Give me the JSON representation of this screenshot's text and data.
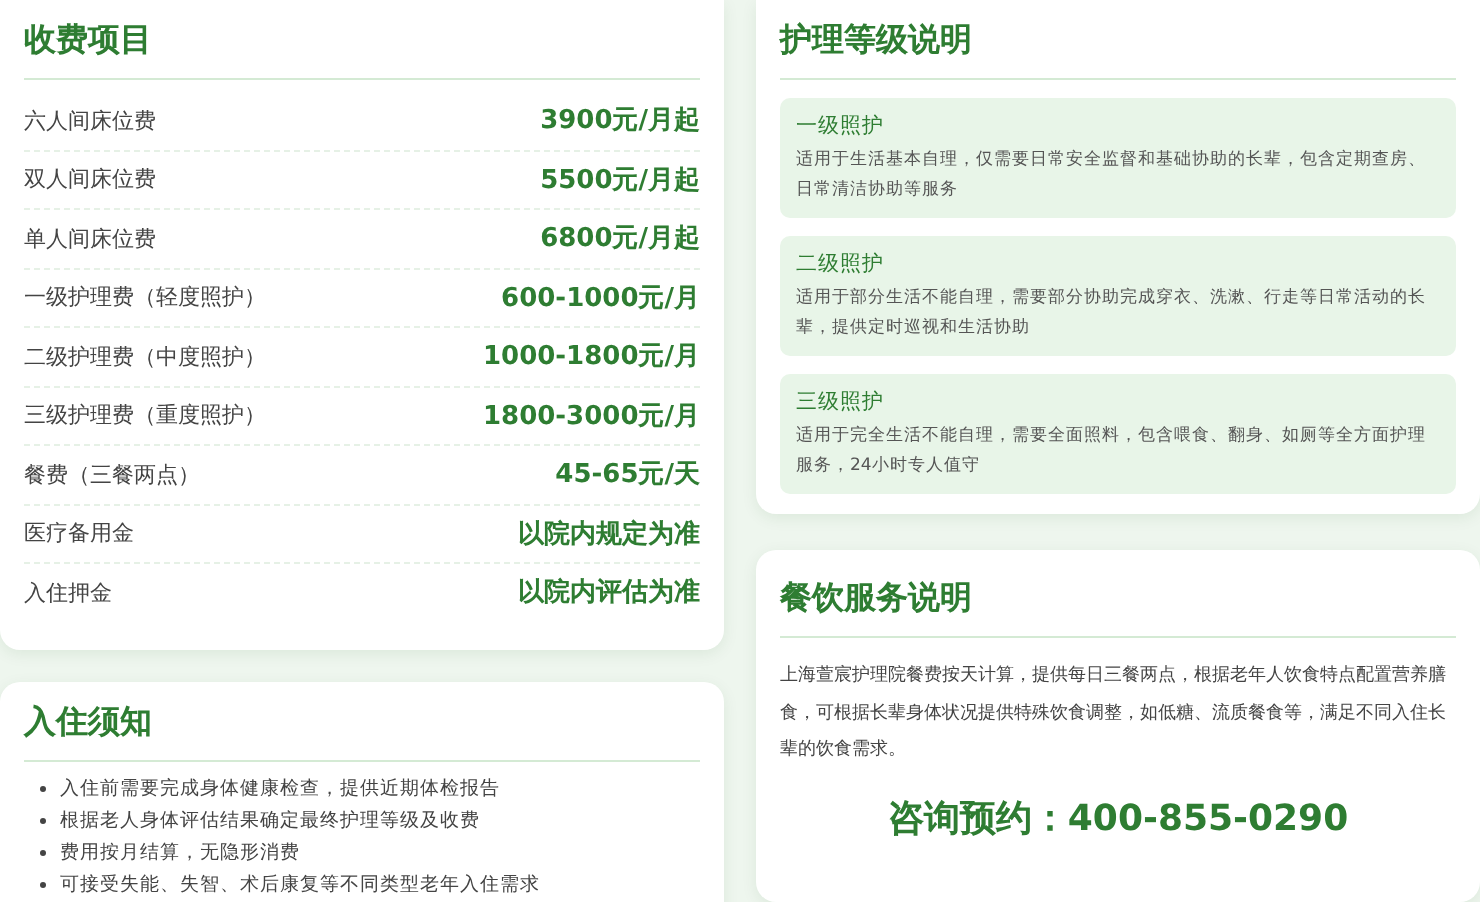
{
  "fees": {
    "title": "收费项目",
    "rows": [
      {
        "label": "六人间床位费",
        "value": "3900元/月起"
      },
      {
        "label": "双人间床位费",
        "value": "5500元/月起"
      },
      {
        "label": "单人间床位费",
        "value": "6800元/月起"
      },
      {
        "label": "一级护理费（轻度照护）",
        "value": "600-1000元/月"
      },
      {
        "label": "二级护理费（中度照护）",
        "value": "1000-1800元/月"
      },
      {
        "label": "三级护理费（重度照护）",
        "value": "1800-3000元/月"
      },
      {
        "label": "餐费（三餐两点）",
        "value": "45-65元/天"
      },
      {
        "label": "医疗备用金",
        "value": "以院内规定为准"
      },
      {
        "label": "入住押金",
        "value": "以院内评估为准"
      }
    ]
  },
  "notice": {
    "title": "入住须知",
    "items": [
      "入住前需要完成身体健康检查，提供近期体检报告",
      "根据老人身体评估结果确定最终护理等级及收费",
      "费用按月结算，无隐形消费",
      "可接受失能、失智、术后康复等不同类型老年入住需求"
    ]
  },
  "care_levels": {
    "title": "护理等级说明",
    "levels": [
      {
        "name": "一级照护",
        "description": "适用于生活基本自理，仅需要日常安全监督和基础协助的长辈，包含定期查房、日常清洁协助等服务"
      },
      {
        "name": "二级照护",
        "description": "适用于部分生活不能自理，需要部分协助完成穿衣、洗漱、行走等日常活动的长辈，提供定时巡视和生活协助"
      },
      {
        "name": "三级照护",
        "description": "适用于完全生活不能自理，需要全面照料，包含喂食、翻身、如厕等全方面护理服务，24小时专人值守"
      }
    ]
  },
  "dining": {
    "title": "餐饮服务说明",
    "text": "上海萱宸护理院餐费按天计算，提供每日三餐两点，根据老年人饮食特点配置营养膳食，可根据长辈身体状况提供特殊饮食调整，如低糖、流质餐食等，满足不同入住长辈的饮食需求。",
    "contact": "咨询预约：400-855-0290"
  }
}
